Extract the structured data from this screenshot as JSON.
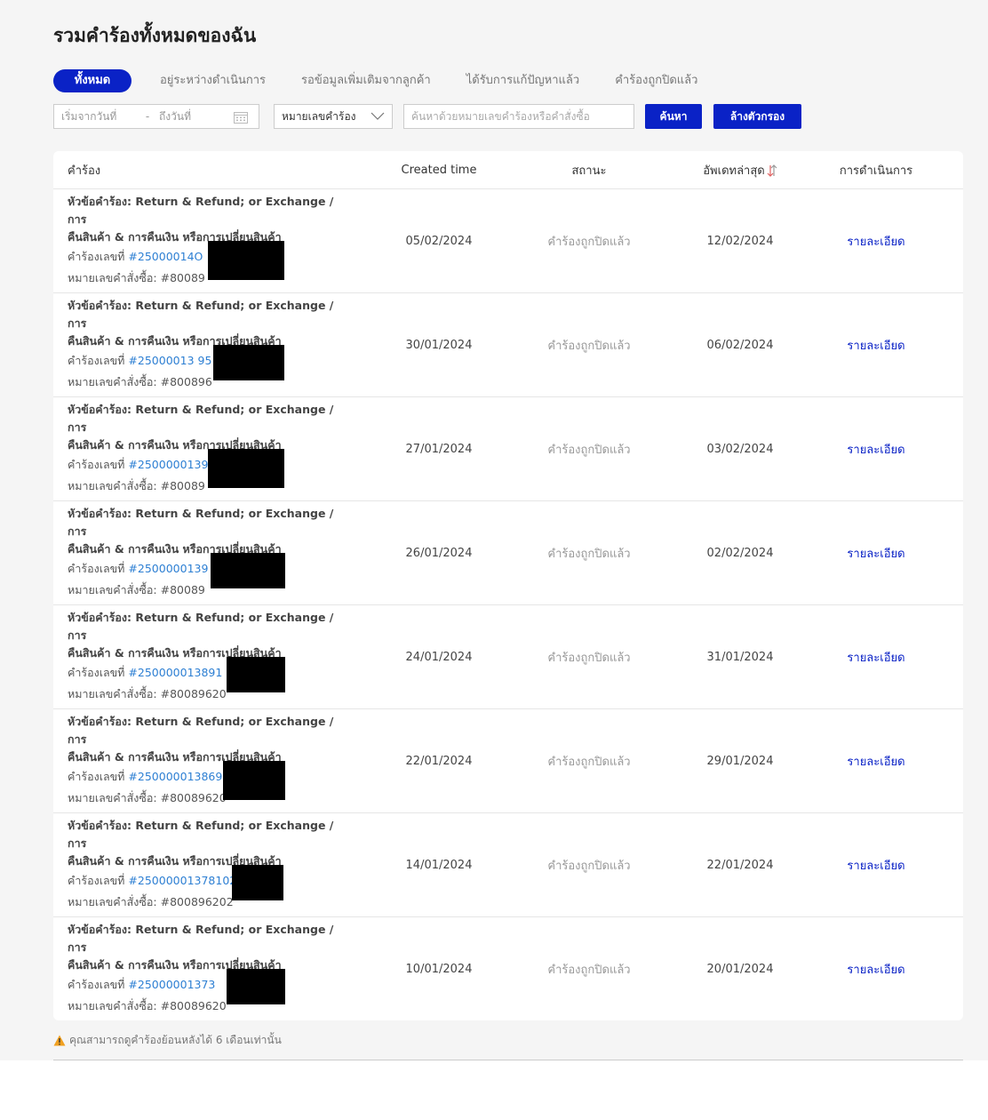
{
  "page": {
    "title": "รวมคำร้องทั้งหมดของฉัน"
  },
  "tabs": [
    {
      "label": "ทั้งหมด",
      "active": true
    },
    {
      "label": "อยู่ระหว่างดำเนินการ",
      "active": false
    },
    {
      "label": "รอข้อมูลเพิ่มเติมจากลูกค้า",
      "active": false
    },
    {
      "label": "ได้รับการแก้ปัญหาแล้ว",
      "active": false
    },
    {
      "label": "คำร้องถูกปิดแล้ว",
      "active": false
    }
  ],
  "filters": {
    "date_from_placeholder": "เริ่มจากวันที่",
    "date_separator": "-",
    "date_to_placeholder": "ถึงวันที่",
    "select_value": "หมายเลขคำร้อง",
    "search_placeholder": "ค้นหาด้วยหมายเลขคำร้องหรือคำสั่งซื้อ",
    "search_button": "ค้นหา",
    "clear_button": "ล้างตัวกรอง"
  },
  "table": {
    "headers": {
      "request": "คำร้อง",
      "created": "Created time",
      "status": "สถานะ",
      "updated": "อัพเดทล่าสุด",
      "action": "การดำเนินการ"
    },
    "labels": {
      "subject_prefix": "หัวข้อคำร้อง: Return & Refund; or Exchange / การ",
      "subject_cont": "คืนสินค้า & การคืนเงิน หรือการเปลี่ยนสินค้า",
      "request_no_label": "คำร้องเลขที่",
      "order_no_label": "หมายเลขคำสั่งซื้อ:"
    },
    "rows": [
      {
        "request_no": "#25000014O",
        "order_no": "#80089",
        "created": "05/02/2024",
        "status": "คำร้องถูกปิดแล้ว",
        "updated": "12/02/2024",
        "action": "รายละเอียด"
      },
      {
        "request_no": "#25000013 95",
        "order_no": "#800896",
        "created": "30/01/2024",
        "status": "คำร้องถูกปิดแล้ว",
        "updated": "06/02/2024",
        "action": "รายละเอียด"
      },
      {
        "request_no": "#2500000139",
        "order_no": "#80089",
        "created": "27/01/2024",
        "status": "คำร้องถูกปิดแล้ว",
        "updated": "03/02/2024",
        "action": "รายละเอียด"
      },
      {
        "request_no": "#2500000139",
        "order_no": "#80089",
        "created": "26/01/2024",
        "status": "คำร้องถูกปิดแล้ว",
        "updated": "02/02/2024",
        "action": "รายละเอียด"
      },
      {
        "request_no": "#250000013891",
        "order_no": "#80089620",
        "created": "24/01/2024",
        "status": "คำร้องถูกปิดแล้ว",
        "updated": "31/01/2024",
        "action": "รายละเอียด"
      },
      {
        "request_no": "#250000013869",
        "order_no": "#80089620",
        "created": "22/01/2024",
        "status": "คำร้องถูกปิดแล้ว",
        "updated": "29/01/2024",
        "action": "รายละเอียด"
      },
      {
        "request_no": "#25000001378102",
        "order_no": "#800896202",
        "created": "14/01/2024",
        "status": "คำร้องถูกปิดแล้ว",
        "updated": "22/01/2024",
        "action": "รายละเอียด"
      },
      {
        "request_no": "#25000001373",
        "order_no": "#80089620",
        "created": "10/01/2024",
        "status": "คำร้องถูกปิดแล้ว",
        "updated": "20/01/2024",
        "action": "รายละเอียด"
      }
    ]
  },
  "notice": {
    "text": "คุณสามารถดูคำร้องย้อนหลังได้ 6 เดือนเท่านั้น",
    "icon": "warning-icon"
  },
  "colors": {
    "primary": "#0a22c6",
    "link": "#2d7fd3",
    "warning": "#f0a020"
  }
}
